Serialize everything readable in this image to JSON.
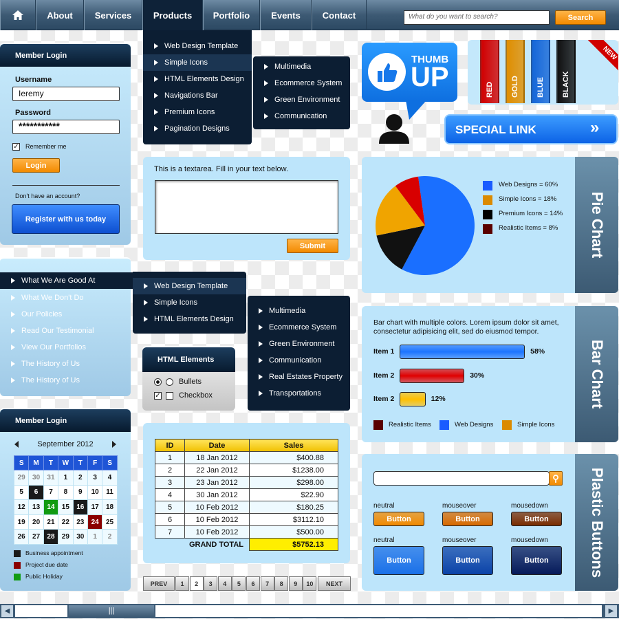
{
  "nav": {
    "home_icon": "home-icon",
    "items": [
      "About",
      "Services",
      "Products",
      "Portfolio",
      "Events",
      "Contact"
    ],
    "active": "Products",
    "search_placeholder": "What do you want to search?",
    "search_button": "Search"
  },
  "products_menu": {
    "items": [
      "Web Design Template",
      "Simple Icons",
      "HTML Elements Design",
      "Navigations Bar",
      "Premium Icons",
      "Pagination Designs"
    ],
    "highlighted": 1,
    "submenu": [
      "Multimedia",
      "Ecommerce System",
      "Green Environment",
      "Communication"
    ]
  },
  "login": {
    "title": "Member Login",
    "username_label": "Username",
    "username_value": "Ieremy",
    "password_label": "Password",
    "password_value": "***********",
    "remember_label": "Remember me",
    "remember_checked": true,
    "login_button": "Login",
    "no_account": "Don't have an account?",
    "register_button": "Register with us today"
  },
  "left_menu": {
    "items": [
      "What We Are Good At",
      "What We Don't Do",
      "Our Policies",
      "Read Our Testimonial",
      "View Our Portfolios",
      "The History of Us",
      "The History of Us"
    ],
    "submenu1": [
      "Web Design Template",
      "Simple Icons",
      "HTML Elements Design"
    ],
    "submenu2": [
      "Multimedia",
      "Ecommerce System",
      "Green Environment",
      "Communication",
      "Real Estates Property",
      "Transportations"
    ]
  },
  "html_elements": {
    "title": "HTML Elements",
    "bullets_label": "Bullets",
    "checkbox_label": "Checkbox"
  },
  "textarea": {
    "label": "This is a textarea. Fill in your text below.",
    "value": "",
    "submit": "Submit"
  },
  "thumb": {
    "line1": "THUMB",
    "line2": "UP",
    "icon": "thumbs-up-icon"
  },
  "ribbons": {
    "items": [
      {
        "label": "RED",
        "color": "#d10000"
      },
      {
        "label": "GOLD",
        "color": "#e08e00"
      },
      {
        "label": "BLUE",
        "color": "#1466d8"
      },
      {
        "label": "BLACK",
        "color": "#111111"
      }
    ],
    "corner": "NEW"
  },
  "special_link": {
    "label": "SPECIAL LINK"
  },
  "pie_panel": {
    "side_label": "Pie Chart"
  },
  "bar_panel": {
    "side_label": "Bar Chart",
    "description": "Bar chart with multiple colors. Lorem ipsum dolor sit amet, consectetur adipisicing elit, sed do eiusmod tempor."
  },
  "chart_data": [
    {
      "type": "pie",
      "slices": [
        {
          "label": "Web Designs = 60%",
          "name": "Web Designs",
          "value": 60,
          "color": "#1a6fff"
        },
        {
          "label": "Premium Icons = 14%",
          "name": "Premium Icons",
          "value": 14,
          "color": "#111111"
        },
        {
          "label": "Simple Icons = 18%",
          "name": "Simple Icons",
          "value": 18,
          "color": "#f0a400"
        },
        {
          "label": "Realistic Items = 8%",
          "name": "Realistic Items",
          "value": 8,
          "color": "#d80000"
        }
      ],
      "legend": [
        {
          "label": "Web Designs = 60%",
          "color": "#1a5cff"
        },
        {
          "label": "Simple Icons = 18%",
          "color": "#db8a00"
        },
        {
          "label": "Premium Icons = 14%",
          "color": "#000000"
        },
        {
          "label": "Realistic Items = 8%",
          "color": "#5a0000"
        }
      ]
    },
    {
      "type": "bar",
      "categories": [
        "Item 1",
        "Item 2",
        "Item 2"
      ],
      "values": [
        58,
        30,
        12
      ],
      "value_labels": [
        "58%",
        "30%",
        "12%"
      ],
      "colors": [
        "#1d74ff",
        "#e00000",
        "#ffbf00"
      ],
      "legend": [
        {
          "label": "Realistic Items",
          "color": "#5a0000"
        },
        {
          "label": "Web Designs",
          "color": "#1a5cff"
        },
        {
          "label": "Simple Icons",
          "color": "#db8a00"
        }
      ]
    }
  ],
  "plastic": {
    "side_label": "Plastic Buttons",
    "rows": [
      [
        {
          "state": "neutral",
          "label": "Button",
          "color": "#f28a00"
        },
        {
          "state": "mouseover",
          "label": "Button",
          "color": "#d86a00"
        },
        {
          "state": "mousedown",
          "label": "Button",
          "color": "#7a2c00"
        }
      ],
      [
        {
          "state": "neutral",
          "label": "Button",
          "color": "#1a70e8"
        },
        {
          "state": "mouseover",
          "label": "Button",
          "color": "#0b43a8"
        },
        {
          "state": "mousedown",
          "label": "Button",
          "color": "#061a5a"
        }
      ]
    ]
  },
  "calendar": {
    "title": "Member Login",
    "month": "September 2012",
    "weekdays": [
      "S",
      "M",
      "T",
      "W",
      "T",
      "F",
      "S"
    ],
    "weeks": [
      [
        [
          "29",
          "o"
        ],
        [
          "30",
          "o"
        ],
        [
          "31",
          "o"
        ],
        [
          "1",
          ""
        ],
        [
          "2",
          ""
        ],
        [
          "3",
          ""
        ],
        [
          "4",
          ""
        ]
      ],
      [
        [
          "5",
          ""
        ],
        [
          "6",
          "b"
        ],
        [
          "7",
          ""
        ],
        [
          "8",
          ""
        ],
        [
          "9",
          ""
        ],
        [
          "10",
          ""
        ],
        [
          "11",
          ""
        ]
      ],
      [
        [
          "12",
          ""
        ],
        [
          "13",
          ""
        ],
        [
          "14",
          "h"
        ],
        [
          "15",
          ""
        ],
        [
          "16",
          "b"
        ],
        [
          "17",
          ""
        ],
        [
          "18",
          ""
        ]
      ],
      [
        [
          "19",
          ""
        ],
        [
          "20",
          ""
        ],
        [
          "21",
          ""
        ],
        [
          "22",
          ""
        ],
        [
          "23",
          ""
        ],
        [
          "24",
          "p"
        ],
        [
          "25",
          ""
        ]
      ],
      [
        [
          "26",
          ""
        ],
        [
          "27",
          ""
        ],
        [
          "28",
          "b"
        ],
        [
          "29",
          ""
        ],
        [
          "30",
          ""
        ],
        [
          "1",
          "o"
        ],
        [
          "2",
          "o"
        ]
      ]
    ],
    "legend": [
      {
        "label": "Business appointment",
        "color": "#1a1a1a"
      },
      {
        "label": "Project due date",
        "color": "#8a0000"
      },
      {
        "label": "Public Holiday",
        "color": "#129b12"
      }
    ]
  },
  "table": {
    "headers": [
      "ID",
      "Date",
      "Sales"
    ],
    "rows": [
      [
        "1",
        "18 Jan 2012",
        "$400.88"
      ],
      [
        "2",
        "22 Jan 2012",
        "$1238.00"
      ],
      [
        "3",
        "23 Jan 2012",
        "$298.00"
      ],
      [
        "4",
        "30 Jan 2012",
        "$22.90"
      ],
      [
        "5",
        "10 Feb 2012",
        "$180.25"
      ],
      [
        "6",
        "10 Feb 2012",
        "$3112.10"
      ],
      [
        "7",
        "10 Feb 2012",
        "$500.00"
      ]
    ],
    "total_label": "GRAND TOTAL",
    "total_value": "$5752.13"
  },
  "pagination": {
    "prev": "PREV",
    "pages": [
      "1",
      "2",
      "3",
      "4",
      "5",
      "6",
      "7",
      "8",
      "9",
      "10"
    ],
    "current": "2",
    "next": "NEXT"
  }
}
